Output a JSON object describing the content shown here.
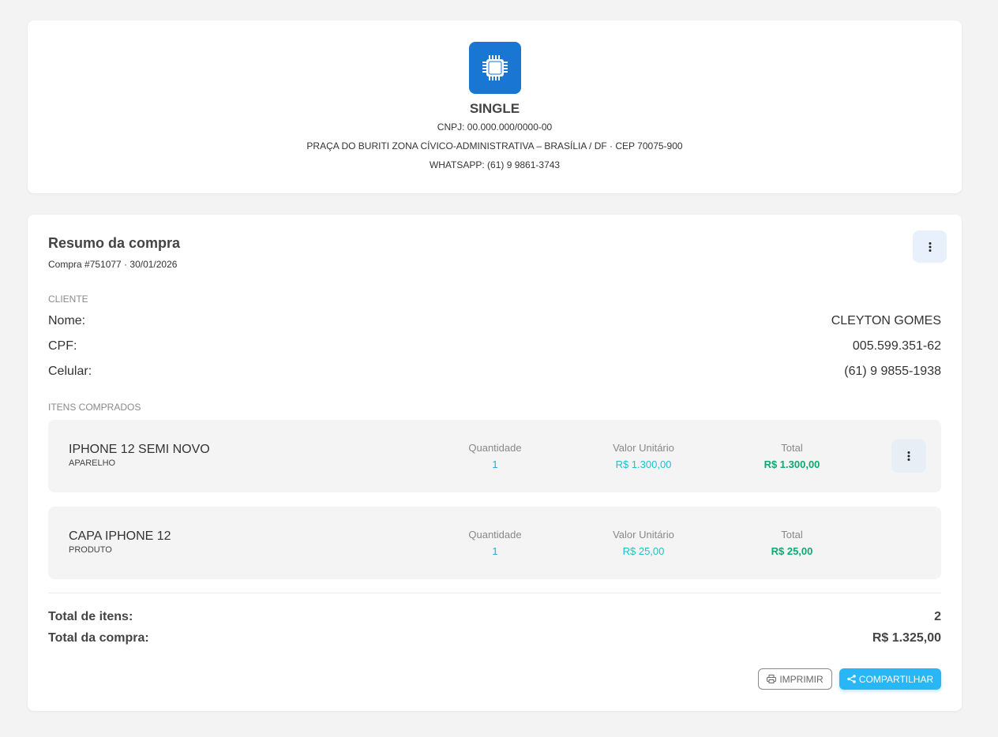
{
  "company": {
    "name": "SINGLE",
    "cnpj": "CNPJ: 00.000.000/0000-00",
    "address": "PRAÇA DO BURITI ZONA CÍVICO-ADMINISTRATIVA – BRASÍLIA / DF · CEP 70075-900",
    "whatsapp": "WHATSAPP: (61) 9 9861-3743",
    "logo_icon": "chip-icon",
    "logo_color": "#1976d2"
  },
  "summary": {
    "title": "Resumo da compra",
    "subtitle": "Compra #751077 · 30/01/2026",
    "menu_icon": "more-vert-icon"
  },
  "client": {
    "section_label": "CLIENTE",
    "rows": [
      {
        "label": "Nome:",
        "value": "CLEYTON GOMES"
      },
      {
        "label": "CPF:",
        "value": "005.599.351-62"
      },
      {
        "label": "Celular:",
        "value": "(61) 9 9855-1938"
      }
    ]
  },
  "items": {
    "section_label": "ITENS COMPRADOS",
    "headers": {
      "qty": "Quantidade",
      "unit": "Valor Unitário",
      "total": "Total"
    },
    "list": [
      {
        "name": "IPHONE 12 SEMI NOVO",
        "category": "APARELHO",
        "qty": "1",
        "unit": "R$ 1.300,00",
        "total": "R$ 1.300,00"
      },
      {
        "name": "CAPA IPHONE 12",
        "category": "PRODUTO",
        "qty": "1",
        "unit": "R$ 25,00",
        "total": "R$ 25,00"
      }
    ]
  },
  "totals": {
    "items_label": "Total de itens:",
    "items_value": "2",
    "purchase_label": "Total da compra:",
    "purchase_value": "R$ 1.325,00"
  },
  "actions": {
    "print_label": "IMPRIMIR",
    "share_label": "COMPARTILHAR",
    "print_icon": "printer-icon",
    "share_icon": "share-icon",
    "share_color": "#29b6f6"
  }
}
